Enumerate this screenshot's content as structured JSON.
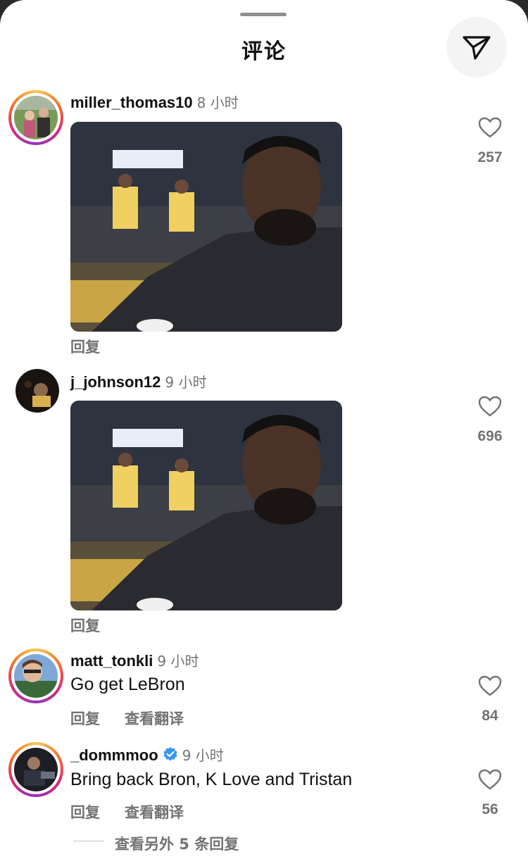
{
  "header": {
    "title": "评论"
  },
  "comments": [
    {
      "username": "miller_thomas10",
      "time": "8 小时",
      "reply_label": "回复",
      "likes": "257"
    },
    {
      "username": "j_johnson12",
      "time": "9 小时",
      "reply_label": "回复",
      "likes": "696"
    },
    {
      "username": "matt_tonkli",
      "time": "9 小时",
      "text": "Go get LeBron",
      "reply_label": "回复",
      "translate_label": "查看翻译",
      "likes": "84"
    },
    {
      "username": "_dommmoo",
      "time": "9 小时",
      "text": "Bring back Bron, K Love and Tristan",
      "reply_label": "回复",
      "translate_label": "查看翻译",
      "likes": "56",
      "verified": true
    }
  ],
  "view_more_replies": "查看另外 5 条回复",
  "colors": {
    "verified": "#3897f0",
    "secondary_text": "#737373"
  }
}
